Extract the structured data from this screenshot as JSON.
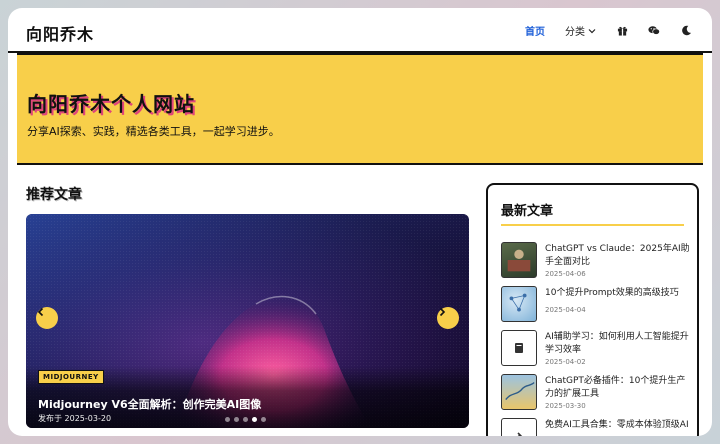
{
  "site": {
    "logo": "向阳乔木"
  },
  "nav": {
    "home": "首页",
    "category": "分类"
  },
  "hero": {
    "title": "向阳乔木个人网站",
    "subtitle": "分享AI探索、实践，精选各类工具，一起学习进步。"
  },
  "featured": {
    "section_title": "推荐文章",
    "tag": "MIDJOURNEY",
    "title": "Midjourney V6全面解析：创作完美AI图像",
    "date": "发布于 2025-03-20",
    "dots_total": 5,
    "active_dot": 3
  },
  "latest": {
    "title": "最新文章",
    "posts": [
      {
        "title": "ChatGPT vs Claude：2025年AI助手全面对比",
        "date": "2025-04-06"
      },
      {
        "title": "10个提升Prompt效果的高级技巧",
        "date": "2025-04-04"
      },
      {
        "title": "AI辅助学习：如何利用人工智能提升学习效率",
        "date": "2025-04-02"
      },
      {
        "title": "ChatGPT必备插件：10个提升生产力的扩展工具",
        "date": "2025-03-30"
      },
      {
        "title": "免费AI工具合集：零成本体验顶级AI",
        "date": ""
      }
    ]
  },
  "colors": {
    "accent": "#f8cf4a",
    "link": "#1e5fd8",
    "pink": "#e0457b"
  }
}
